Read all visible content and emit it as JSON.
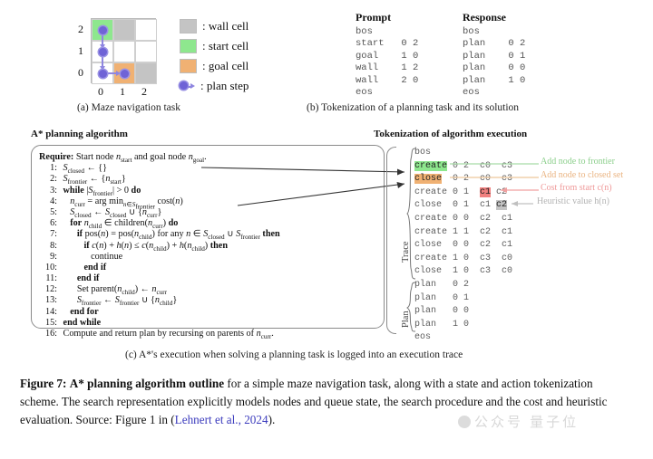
{
  "figure": {
    "label": "Figure 7:",
    "bold_title": "A* planning algorithm outline",
    "body_1": " for a simple maze navigation task, along with a state and",
    "body_2": "action tokenization scheme. The search representation explicitly models nodes and queue state, the",
    "body_3": "search procedure and the cost and heuristic evaluation. Source: Figure 1 in (",
    "citation": "Lehnert et al., 2024",
    "body_4": ")."
  },
  "panel_a": {
    "caption": "(a) Maze navigation task",
    "axis": {
      "x_ticks": [
        "0",
        "1",
        "2"
      ],
      "y_ticks": [
        "2",
        "1",
        "0"
      ]
    },
    "grid": [
      [
        {
          "type": "start"
        },
        {
          "type": "wall"
        },
        {
          "type": "empty"
        }
      ],
      [
        {
          "type": "empty"
        },
        {
          "type": "empty"
        },
        {
          "type": "empty"
        }
      ],
      [
        {
          "type": "empty"
        },
        {
          "type": "goal"
        },
        {
          "type": "wall"
        }
      ]
    ],
    "plan_cells": [
      "0 2",
      "0 1",
      "0 0",
      "1 0"
    ],
    "legend": [
      {
        "icon": "wall-swatch",
        "color": "#c4c4c4",
        "label": ": wall cell"
      },
      {
        "icon": "start-swatch",
        "color": "#8ee78e",
        "label": ": start cell"
      },
      {
        "icon": "goal-swatch",
        "color": "#f0b173",
        "label": ": goal cell"
      },
      {
        "icon": "plan-step-icon",
        "color": "#6f63d6",
        "label": ": plan step"
      }
    ]
  },
  "panel_b": {
    "caption": "(b) Tokenization of a planning task and its solution",
    "prompt": {
      "title": "Prompt",
      "rows": [
        "bos",
        "start   0 2",
        "goal    1 0",
        "wall    1 2",
        "wall    2 0",
        "eos"
      ]
    },
    "response": {
      "title": "Response",
      "rows": [
        "bos",
        "plan    0 2",
        "plan    0 1",
        "plan    0 0",
        "plan    1 0",
        "eos"
      ]
    }
  },
  "panel_c": {
    "caption": "(c) A*'s execution when solving a planning task is logged into an execution trace",
    "algo_heading": "A* planning algorithm",
    "trace_heading": "Tokenization of algorithm execution",
    "algorithm": {
      "require": "Require: Start node n_start and goal node n_goal.",
      "lines": [
        {
          "num": "1:",
          "indent": 0,
          "text": "S_closed ← {}"
        },
        {
          "num": "2:",
          "indent": 0,
          "text": "S_frontier ← {n_start}"
        },
        {
          "num": "3:",
          "indent": 0,
          "text": "while |S_frontier| > 0 do"
        },
        {
          "num": "4:",
          "indent": 1,
          "text": "n_curr = arg min_{n∈S_frontier} cost(n)"
        },
        {
          "num": "5:",
          "indent": 1,
          "text": "S_closed ← S_closed ∪ {n_curr}"
        },
        {
          "num": "6:",
          "indent": 1,
          "text": "for n_child ∈ children(n_curr) do"
        },
        {
          "num": "7:",
          "indent": 2,
          "text": "if pos(n) = pos(n_child) for any n ∈ S_closed ∪ S_frontier then"
        },
        {
          "num": "8:",
          "indent": 3,
          "text": "if c(n) + h(n) ≤ c(n_child) + h(n_child) then"
        },
        {
          "num": "9:",
          "indent": 4,
          "text": "continue"
        },
        {
          "num": "10:",
          "indent": 3,
          "text": "end if"
        },
        {
          "num": "11:",
          "indent": 2,
          "text": "end if"
        },
        {
          "num": "12:",
          "indent": 2,
          "text": "Set parent(n_child) ← n_curr"
        },
        {
          "num": "13:",
          "indent": 2,
          "text": "S_frontier ← S_frontier ∪ {n_child}"
        },
        {
          "num": "14:",
          "indent": 1,
          "text": "end for"
        },
        {
          "num": "15:",
          "indent": 0,
          "text": "end while"
        },
        {
          "num": "16:",
          "indent": 0,
          "text": "Compute and return plan by recursing on parents of n_curr."
        }
      ]
    },
    "trace": {
      "group_label": "Trace",
      "plan_label": "Plan",
      "rows": [
        {
          "op": "bos",
          "args": "",
          "op_hl": "none"
        },
        {
          "op": "create",
          "args": "0 2  c0  c3",
          "op_hl": "green"
        },
        {
          "op": "close",
          "args": "0 2  c0  c3",
          "op_hl": "orange"
        },
        {
          "op": "create",
          "args": "0 1  c1  c2",
          "op_hl": "none",
          "arg_hl": "red"
        },
        {
          "op": "close",
          "args": "0 1  c1  c2",
          "op_hl": "none",
          "arg_hl": "gray"
        },
        {
          "op": "create",
          "args": "0 0  c2  c1",
          "op_hl": "none"
        },
        {
          "op": "create",
          "args": "1 1  c2  c1",
          "op_hl": "none"
        },
        {
          "op": "close",
          "args": "0 0  c2  c1",
          "op_hl": "none"
        },
        {
          "op": "create",
          "args": "1 0  c3  c0",
          "op_hl": "none"
        },
        {
          "op": "close",
          "args": "1 0  c3  c0",
          "op_hl": "none"
        },
        {
          "op": "plan",
          "args": "0 2",
          "op_hl": "none"
        },
        {
          "op": "plan",
          "args": "0 1",
          "op_hl": "none"
        },
        {
          "op": "plan",
          "args": "0 0",
          "op_hl": "none"
        },
        {
          "op": "plan",
          "args": "1 0",
          "op_hl": "none"
        },
        {
          "op": "eos",
          "args": "",
          "op_hl": "none"
        }
      ],
      "annotations": [
        {
          "text": "Add node to frontier",
          "color": "green"
        },
        {
          "text": "Add node to closed set",
          "color": "orange"
        },
        {
          "text": "Cost from start c(n)",
          "color": "red"
        },
        {
          "text": "Heuristic value h(n)",
          "color": "gray"
        }
      ]
    }
  },
  "watermark": {
    "text": "公众号 量子位"
  }
}
